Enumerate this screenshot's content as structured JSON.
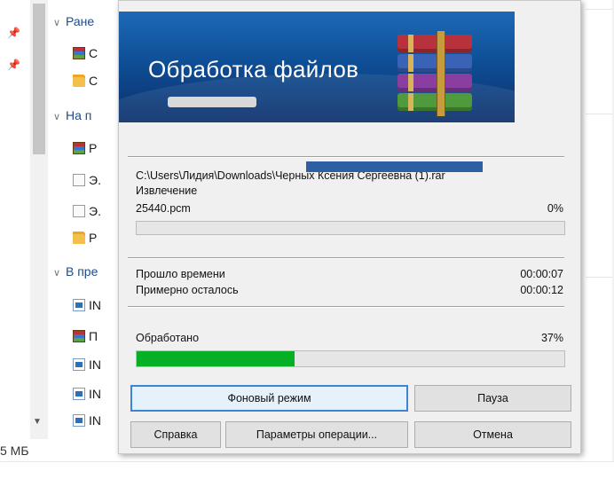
{
  "explorer": {
    "groups": [
      {
        "label": "Ране"
      },
      {
        "label": "На п"
      },
      {
        "label": "В пре"
      }
    ],
    "items": [
      {
        "label": "С",
        "icon": "rar-archive-icon"
      },
      {
        "label": "С",
        "icon": "folder-icon"
      },
      {
        "label": "Р",
        "icon": "rar-archive-icon"
      },
      {
        "label": "Э.",
        "icon": "document-icon"
      },
      {
        "label": "Э.",
        "icon": "document-icon"
      },
      {
        "label": "Р",
        "icon": "folder-icon"
      },
      {
        "label": "IN",
        "icon": "image-file-icon"
      },
      {
        "label": "П",
        "icon": "rar-archive-icon"
      },
      {
        "label": "IN",
        "icon": "image-file-icon"
      },
      {
        "label": "IN",
        "icon": "image-file-icon"
      },
      {
        "label": "IN",
        "icon": "image-file-icon"
      }
    ],
    "size_text": "5 МБ"
  },
  "dialog": {
    "banner_title": "Обработка файлов",
    "archive_path": "C:\\Users\\Лидия\\Downloads\\Черных Ксения Сергеевна (1).rar",
    "operation": "Извлечение",
    "current_file": "25440.pcm",
    "file_percent_text": "0%",
    "file_progress": 0.0,
    "elapsed_label": "Прошло времени",
    "elapsed_value": "00:00:07",
    "remaining_label": "Примерно осталось",
    "remaining_value": "00:00:12",
    "processed_label": "Обработано",
    "processed_percent_text": "37%",
    "processed_progress": 0.37,
    "buttons": {
      "background": "Фоновый режим",
      "pause": "Пауза",
      "help": "Справка",
      "options": "Параметры операции...",
      "cancel": "Отмена"
    },
    "colors": {
      "progress_fill": "#06b025",
      "banner": "#1d69b6"
    }
  }
}
